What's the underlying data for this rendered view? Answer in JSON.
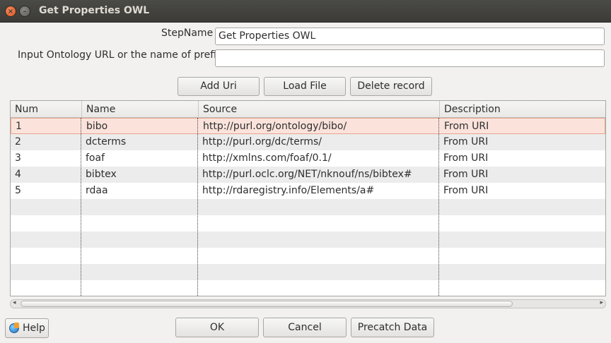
{
  "window": {
    "title": "Get Properties OWL"
  },
  "form": {
    "stepname_label": "StepName",
    "stepname_value": "Get Properties OWL",
    "ontology_label": "Input Ontology URL or the name of prefix",
    "ontology_value": ""
  },
  "toolbar": {
    "add_uri": "Add Uri",
    "load_file": "Load File",
    "delete_record": "Delete record"
  },
  "table": {
    "columns": [
      "Num",
      "Name",
      "Source",
      "Description"
    ],
    "rows": [
      [
        "1",
        "bibo",
        "http://purl.org/ontology/bibo/",
        "From URI"
      ],
      [
        "2",
        "dcterms",
        "http://purl.org/dc/terms/",
        "From URI"
      ],
      [
        "3",
        "foaf",
        "http://xmlns.com/foaf/0.1/",
        "From URI"
      ],
      [
        "4",
        "bibtex",
        "http://purl.oclc.org/NET/nknouf/ns/bibtex#",
        "From URI"
      ],
      [
        "5",
        "rdaa",
        "http://rdaregistry.info/Elements/a#",
        "From URI"
      ]
    ]
  },
  "footer": {
    "help": "Help",
    "ok": "OK",
    "cancel": "Cancel",
    "precatch": "Precatch Data"
  }
}
